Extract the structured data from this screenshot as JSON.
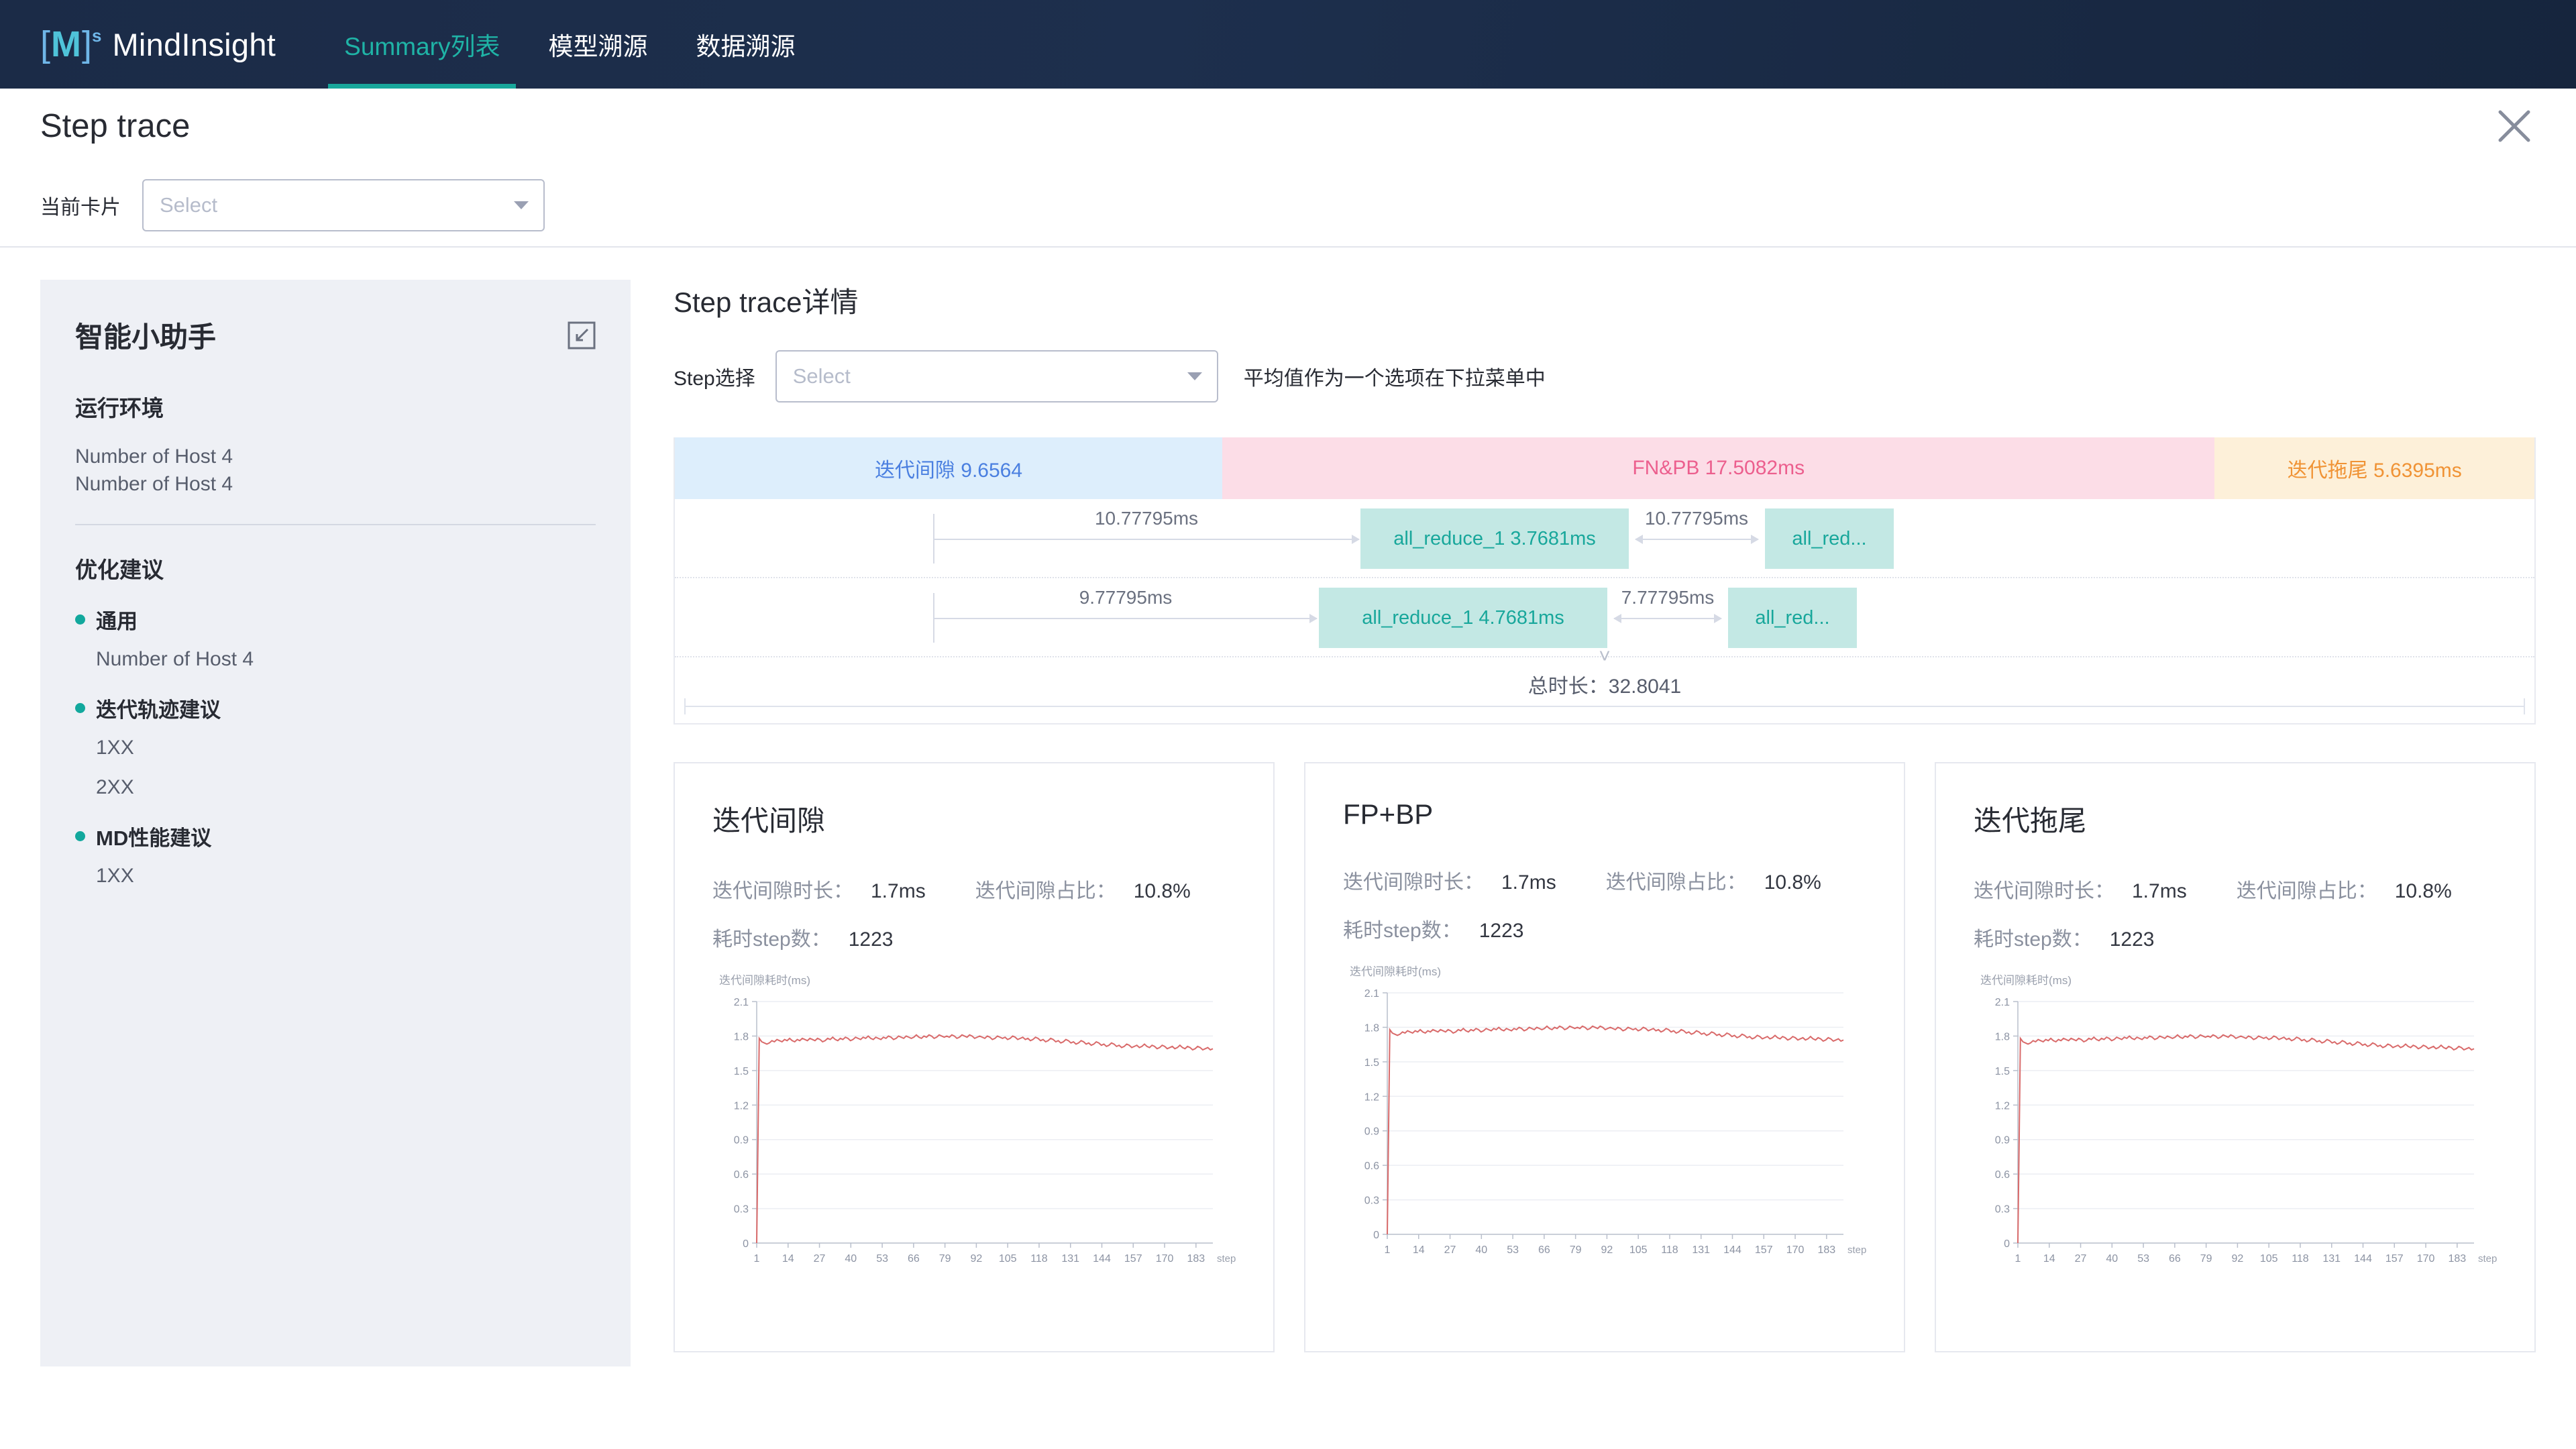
{
  "header": {
    "brand": "MindInsight",
    "logo_bracket_left": "[",
    "logo_letter": "M",
    "logo_bracket_right": "]",
    "logo_superscript": "s",
    "tabs": [
      {
        "label": "Summary列表",
        "active": true
      },
      {
        "label": "模型溯源",
        "active": false
      },
      {
        "label": "数据溯源",
        "active": false
      }
    ]
  },
  "page": {
    "title": "Step trace",
    "close_icon": "close-icon"
  },
  "card_selector": {
    "label": "当前卡片",
    "placeholder": "Select",
    "value": ""
  },
  "sidebar": {
    "title": "智能小助手",
    "collapse_icon": "collapse-icon",
    "env_section": {
      "title": "运行环境",
      "lines": [
        "Number of Host 4",
        "Number of Host 4"
      ]
    },
    "suggestion_section": {
      "title": "优化建议",
      "items": [
        {
          "label": "通用",
          "body": [
            "Number of Host 4"
          ]
        },
        {
          "label": "迭代轨迹建议",
          "body": [
            "1XX",
            "2XX"
          ]
        },
        {
          "label": "MD性能建议",
          "body": [
            "1XX"
          ]
        }
      ]
    }
  },
  "main": {
    "title": "Step trace详情",
    "step_selector": {
      "label": "Step选择",
      "placeholder": "Select",
      "value": "",
      "hint": "平均值作为一个选项在下拉菜单中"
    },
    "phases": [
      {
        "name": "迭代间隙",
        "value": "9.6564",
        "label": "迭代间隙  9.6564",
        "color": "#ddeefc",
        "text_color": "#4a7fe0",
        "weight": 9.6564
      },
      {
        "name": "FN&PB",
        "value": "17.5082ms",
        "label": "FN&PB  17.5082ms",
        "color": "#fcdde7",
        "text_color": "#ec5f8e",
        "weight": 17.5082
      },
      {
        "name": "迭代拖尾",
        "value": "5.6395ms",
        "label": "迭代拖尾  5.6395ms",
        "color": "#fdf0d9",
        "text_color": "#f09335",
        "weight": 5.6395
      }
    ],
    "gantt_rows": [
      {
        "lead_duration": "10.77795ms",
        "op_label": "all_reduce_1  3.7681ms",
        "gap_duration": "10.77795ms",
        "tail_op_label": "all_red..."
      },
      {
        "lead_duration": "9.77795ms",
        "op_label": "all_reduce_1  4.7681ms",
        "gap_duration": "7.77795ms",
        "tail_op_label": "all_red..."
      }
    ],
    "expand_icon": "chevron-double-down-icon",
    "total": "总时长：32.8041"
  },
  "metric_cards": [
    {
      "title": "迭代间隙",
      "metrics": [
        {
          "label": "迭代间隙时长：",
          "value": "1.7ms"
        },
        {
          "label": "迭代间隙占比：",
          "value": "10.8%"
        },
        {
          "label": "耗时step数：",
          "value": "1223"
        }
      ]
    },
    {
      "title": "FP+BP",
      "metrics": [
        {
          "label": "迭代间隙时长：",
          "value": "1.7ms"
        },
        {
          "label": "迭代间隙占比：",
          "value": "10.8%"
        },
        {
          "label": "耗时step数：",
          "value": "1223"
        }
      ]
    },
    {
      "title": "迭代拖尾",
      "metrics": [
        {
          "label": "迭代间隙时长：",
          "value": "1.7ms"
        },
        {
          "label": "迭代间隙占比：",
          "value": "10.8%"
        },
        {
          "label": "耗时step数：",
          "value": "1223"
        }
      ]
    }
  ],
  "chart_data": {
    "type": "line",
    "title": "迭代间隙耗时(ms)",
    "xlabel": "step",
    "ylabel": "",
    "xlim": [
      1,
      190
    ],
    "ylim": [
      0,
      2.1
    ],
    "yticks": [
      0,
      0.3,
      0.6,
      0.9,
      1.2,
      1.5,
      1.8,
      2.1
    ],
    "ytick_labels": [
      "0",
      "0.3",
      "0.6",
      "0.9",
      "1.2",
      "1.5",
      "1.8",
      "2.1"
    ],
    "xticks": [
      1,
      14,
      27,
      40,
      53,
      66,
      79,
      92,
      105,
      118,
      131,
      144,
      157,
      170,
      183
    ],
    "xtick_labels": [
      "1",
      "14",
      "27",
      "40",
      "53",
      "66",
      "79",
      "92",
      "105",
      "118",
      "131",
      "144",
      "157",
      "170",
      "183"
    ],
    "grid": true,
    "legend": false,
    "line_color": "#d96a6a",
    "series": [
      {
        "name": "迭代间隙耗时",
        "values": [
          0,
          1.78,
          1.75,
          1.74,
          1.73,
          1.74,
          1.76,
          1.75,
          1.77,
          1.76,
          1.75,
          1.77,
          1.76,
          1.78,
          1.76,
          1.75,
          1.77,
          1.76,
          1.78,
          1.77,
          1.76,
          1.78,
          1.77,
          1.76,
          1.78,
          1.77,
          1.75,
          1.76,
          1.78,
          1.77,
          1.79,
          1.77,
          1.76,
          1.78,
          1.77,
          1.79,
          1.78,
          1.76,
          1.77,
          1.79,
          1.78,
          1.77,
          1.79,
          1.78,
          1.8,
          1.78,
          1.77,
          1.79,
          1.78,
          1.77,
          1.79,
          1.78,
          1.8,
          1.79,
          1.77,
          1.78,
          1.8,
          1.79,
          1.78,
          1.8,
          1.79,
          1.78,
          1.79,
          1.81,
          1.79,
          1.78,
          1.8,
          1.79,
          1.81,
          1.8,
          1.78,
          1.79,
          1.81,
          1.8,
          1.79,
          1.8,
          1.79,
          1.81,
          1.8,
          1.78,
          1.79,
          1.81,
          1.8,
          1.79,
          1.81,
          1.8,
          1.78,
          1.79,
          1.8,
          1.79,
          1.78,
          1.8,
          1.79,
          1.77,
          1.78,
          1.8,
          1.79,
          1.78,
          1.79,
          1.77,
          1.78,
          1.8,
          1.79,
          1.77,
          1.78,
          1.79,
          1.77,
          1.78,
          1.76,
          1.77,
          1.79,
          1.78,
          1.76,
          1.77,
          1.75,
          1.76,
          1.78,
          1.77,
          1.75,
          1.76,
          1.74,
          1.75,
          1.77,
          1.76,
          1.74,
          1.75,
          1.73,
          1.74,
          1.76,
          1.75,
          1.73,
          1.74,
          1.72,
          1.73,
          1.75,
          1.74,
          1.72,
          1.73,
          1.71,
          1.72,
          1.74,
          1.73,
          1.71,
          1.72,
          1.7,
          1.71,
          1.73,
          1.72,
          1.7,
          1.71,
          1.72,
          1.7,
          1.71,
          1.73,
          1.71,
          1.7,
          1.72,
          1.71,
          1.69,
          1.7,
          1.72,
          1.71,
          1.69,
          1.7,
          1.71,
          1.69,
          1.7,
          1.72,
          1.7,
          1.69,
          1.71,
          1.7,
          1.68,
          1.69,
          1.71,
          1.7,
          1.68,
          1.69,
          1.7,
          1.68,
          1.69
        ]
      }
    ]
  }
}
